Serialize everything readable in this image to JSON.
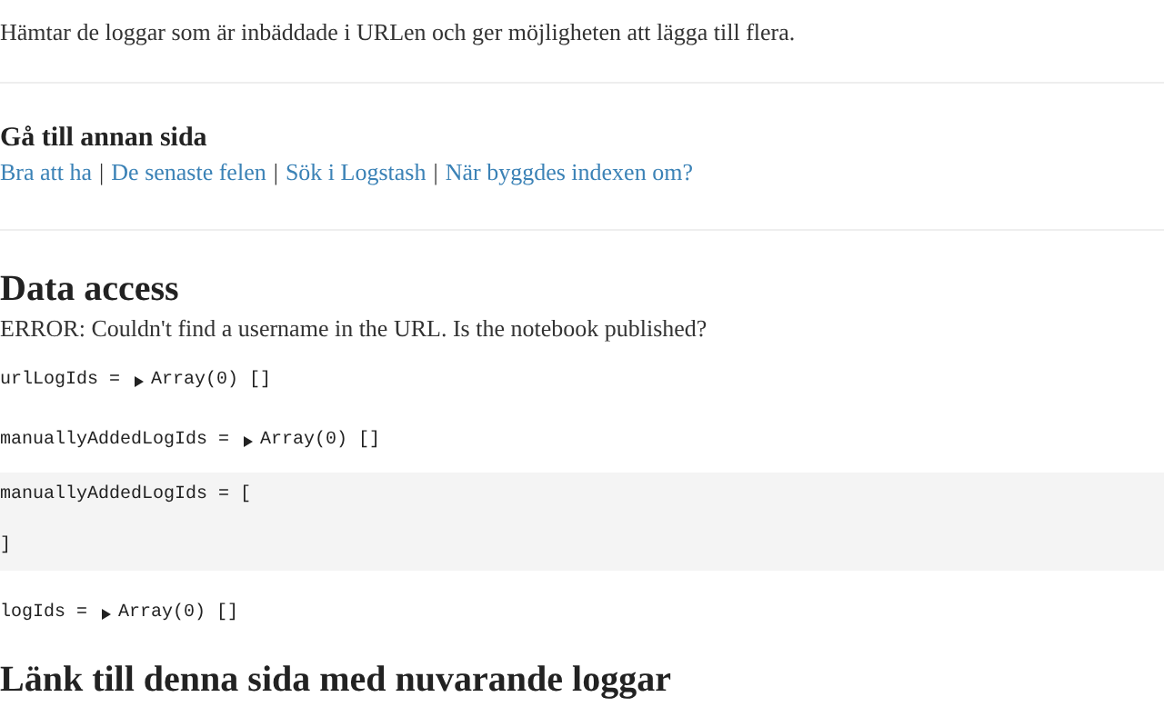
{
  "intro": "Hämtar de loggar som är inbäddade i URLen och ger möjligheten att lägga till flera.",
  "navigation": {
    "heading": "Gå till annan sida",
    "separator": "|",
    "links": [
      "Bra att ha",
      "De senaste felen",
      "Sök i Logstash",
      "När byggdes indexen om?"
    ]
  },
  "data_access": {
    "heading": "Data access",
    "error": "ERROR: Couldn't find a username in the URL. Is the notebook published?"
  },
  "cells": [
    {
      "kind": "output",
      "text": "urlLogIds = ",
      "value": "Array(0) []"
    },
    {
      "kind": "output",
      "text": "manuallyAddedLogIds = ",
      "value": "Array(0) []"
    },
    {
      "kind": "editor",
      "lines": [
        "manuallyAddedLogIds = [",
        "]"
      ]
    },
    {
      "kind": "output",
      "text": "logIds = ",
      "value": "Array(0) []"
    }
  ],
  "link_section": {
    "heading": "Länk till denna sida med nuvarande loggar"
  }
}
